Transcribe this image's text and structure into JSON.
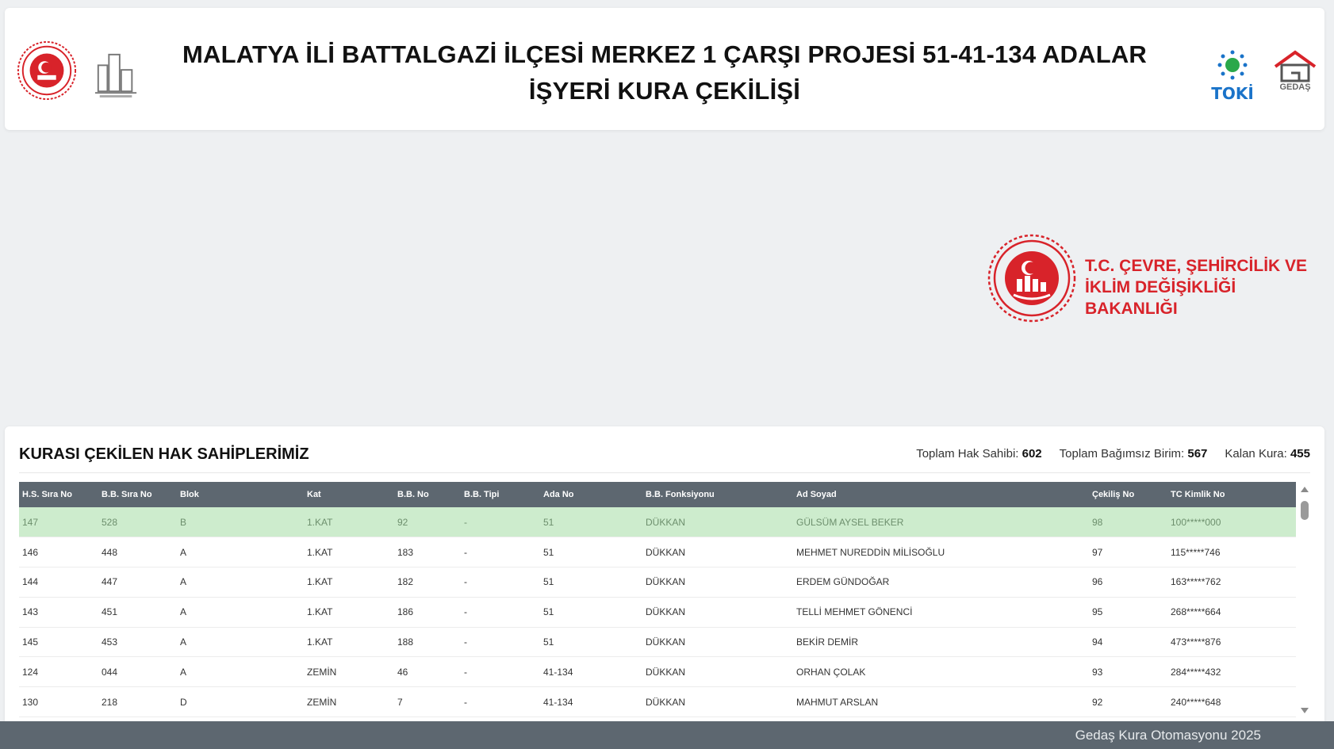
{
  "header": {
    "title": "MALATYA İLİ BATTALGAZİ İLÇESİ MERKEZ 1 ÇARŞI PROJESİ 51-41-134 ADALAR İŞYERİ KURA ÇEKİLİŞİ",
    "logos": {
      "left_emblem": "ministry-emblem-icon",
      "city_logo": "city-buildings-icon",
      "toki_label": "TOKİ",
      "gedas_label": "GEDAŞ"
    }
  },
  "ministry": {
    "name_line1": "T.C. ÇEVRE, ŞEHİRCİLİK VE",
    "name_line2": "İKLİM DEĞİŞİKLİĞİ BAKANLIĞI",
    "color": "#d8232a"
  },
  "panel": {
    "title": "KURASI ÇEKİLEN HAK SAHİPLERİMİZ",
    "stats": [
      {
        "label": "Toplam Hak Sahibi:",
        "value": "602"
      },
      {
        "label": "Toplam Bağımsız Birim:",
        "value": "567"
      },
      {
        "label": "Kalan Kura:",
        "value": "455"
      }
    ]
  },
  "table": {
    "columns": [
      "H.S. Sıra No",
      "B.B. Sıra No",
      "Blok",
      "Kat",
      "B.B. No",
      "B.B. Tipi",
      "Ada No",
      "B.B. Fonksiyonu",
      "Ad Soyad",
      "Çekiliş No",
      "TC Kimlik No"
    ],
    "rows": [
      [
        "147",
        "528",
        "B",
        "1.KAT",
        "92",
        "-",
        "51",
        "DÜKKAN",
        "GÜLSÜM AYSEL BEKER",
        "98",
        "100*****000"
      ],
      [
        "146",
        "448",
        "A",
        "1.KAT",
        "183",
        "-",
        "51",
        "DÜKKAN",
        "MEHMET NUREDDİN MİLİSOĞLU",
        "97",
        "115*****746"
      ],
      [
        "144",
        "447",
        "A",
        "1.KAT",
        "182",
        "-",
        "51",
        "DÜKKAN",
        "ERDEM GÜNDOĞAR",
        "96",
        "163*****762"
      ],
      [
        "143",
        "451",
        "A",
        "1.KAT",
        "186",
        "-",
        "51",
        "DÜKKAN",
        "TELLİ MEHMET GÖNENCİ",
        "95",
        "268*****664"
      ],
      [
        "145",
        "453",
        "A",
        "1.KAT",
        "188",
        "-",
        "51",
        "DÜKKAN",
        "BEKİR DEMİR",
        "94",
        "473*****876"
      ],
      [
        "124",
        "044",
        "A",
        "ZEMİN",
        "46",
        "-",
        "41-134",
        "DÜKKAN",
        "ORHAN ÇOLAK",
        "93",
        "284*****432"
      ],
      [
        "130",
        "218",
        "D",
        "ZEMİN",
        "7",
        "-",
        "41-134",
        "DÜKKAN",
        "MAHMUT ARSLAN",
        "92",
        "240*****648"
      ]
    ]
  },
  "footer": {
    "text": "Gedaş Kura Otomasyonu 2025"
  }
}
